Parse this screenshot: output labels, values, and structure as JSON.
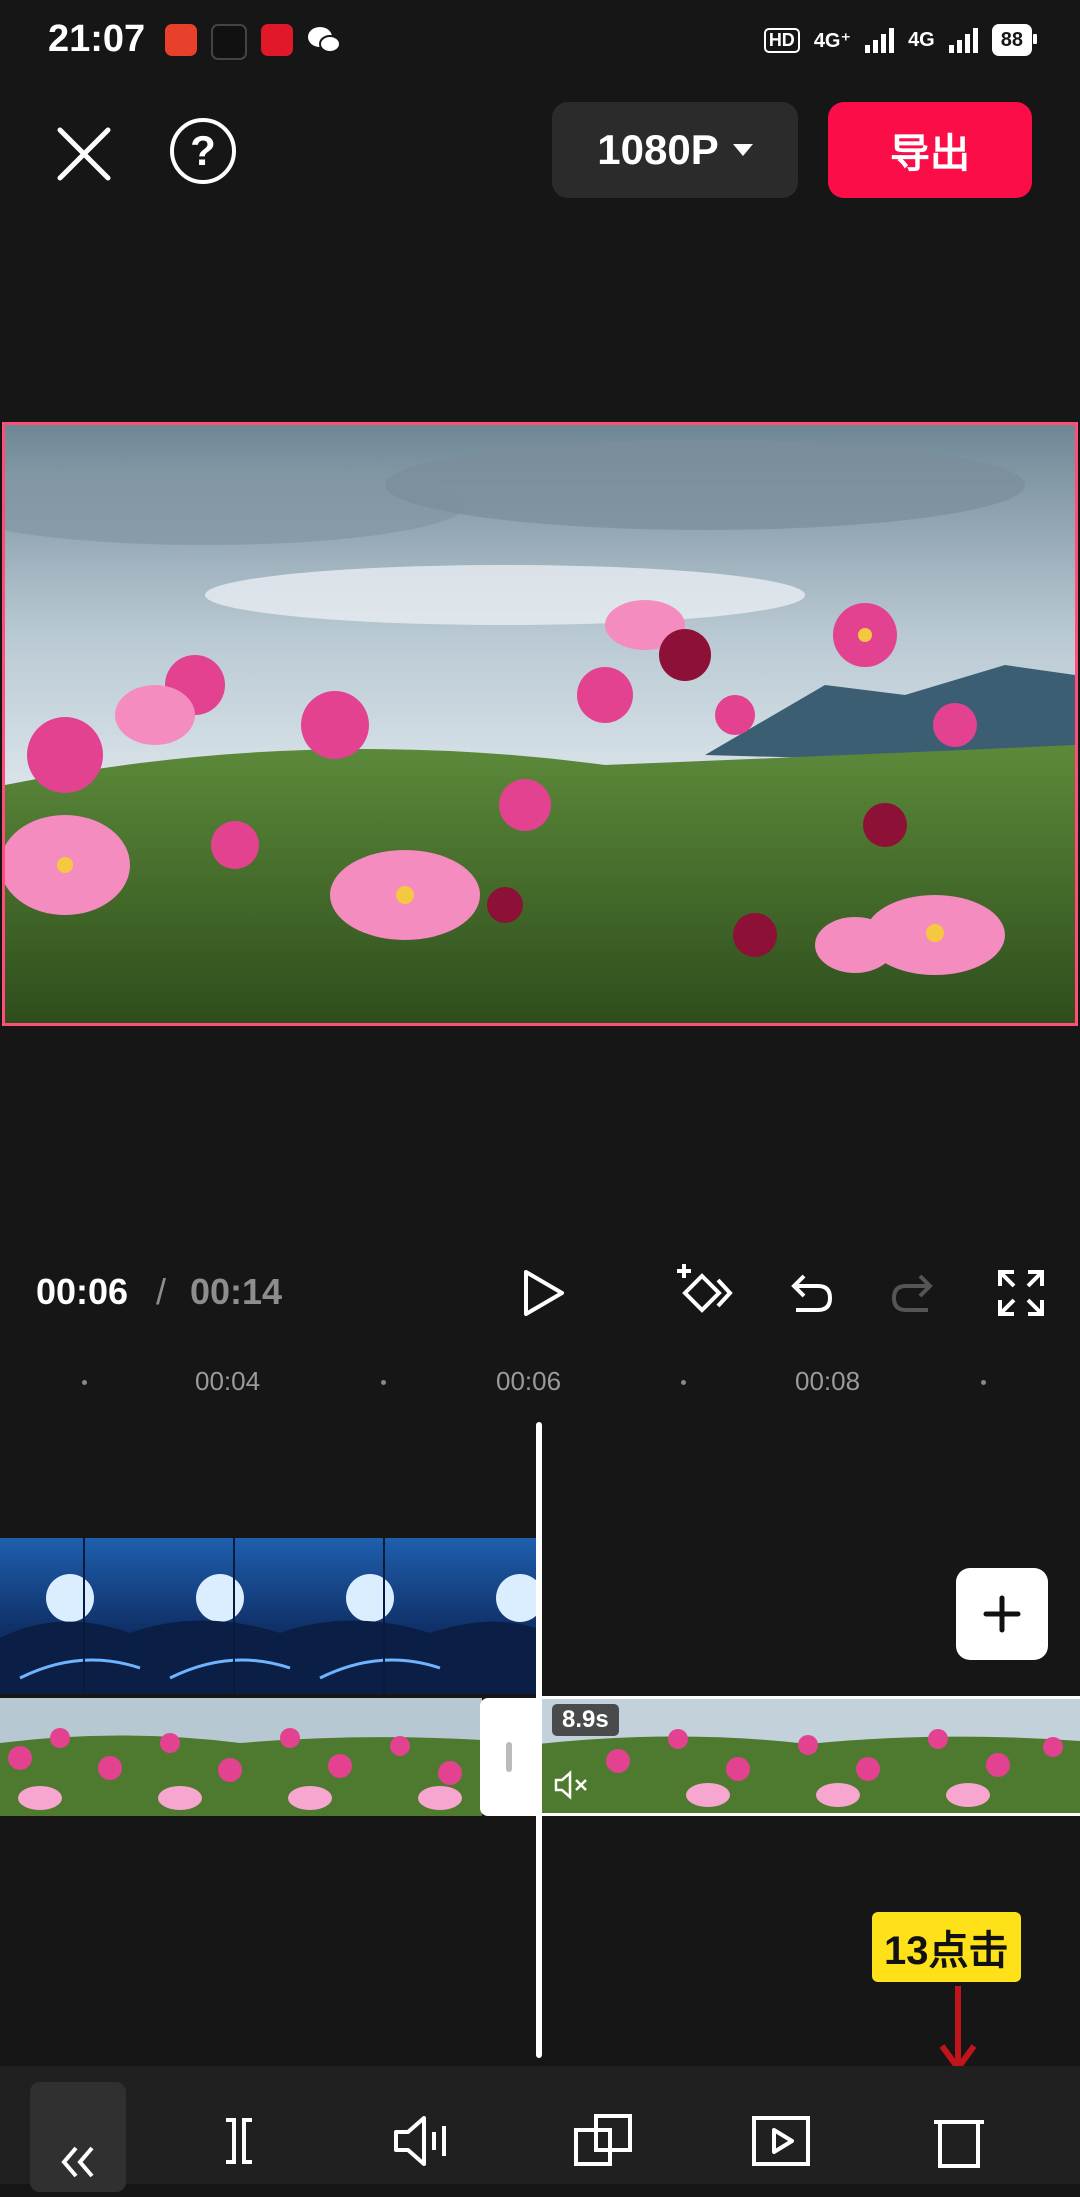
{
  "status_bar": {
    "time": "21:07",
    "hd_label": "HD",
    "network_1": "4G⁺",
    "network_2": "4G",
    "battery": "88"
  },
  "top_bar": {
    "resolution": "1080P",
    "export_label": "导出"
  },
  "playback": {
    "current_time": "00:06",
    "separator": "/",
    "total_time": "00:14"
  },
  "timeline": {
    "ticks": [
      "00:04",
      "00:06",
      "00:08"
    ],
    "clip_duration": "8.9s"
  },
  "annotation": {
    "text": "13点击"
  },
  "colors": {
    "accent": "#fb0d47",
    "annotation_bg": "#ffe11a",
    "annotation_arrow": "#c0151c"
  }
}
